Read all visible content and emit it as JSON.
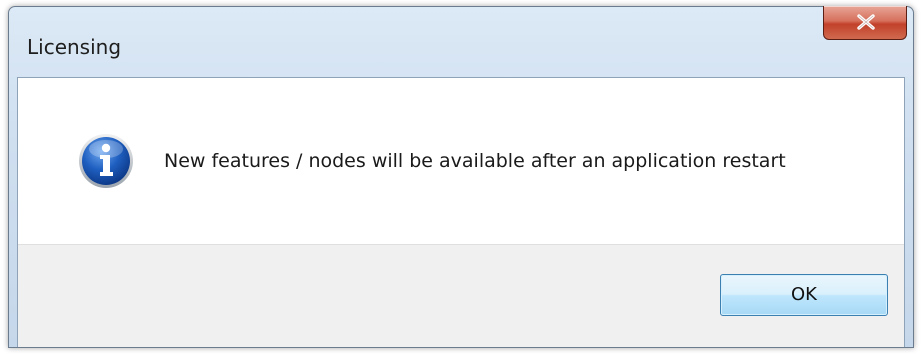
{
  "window": {
    "title": "Licensing",
    "close_icon": "close-icon"
  },
  "dialog": {
    "icon": "info-icon",
    "message": "New features / nodes will be available after an application restart"
  },
  "buttons": {
    "ok_label": "OK"
  },
  "colors": {
    "info_icon_blue": "#1f5fc0",
    "close_red": "#c2412a",
    "ok_border": "#3c7fb1"
  }
}
